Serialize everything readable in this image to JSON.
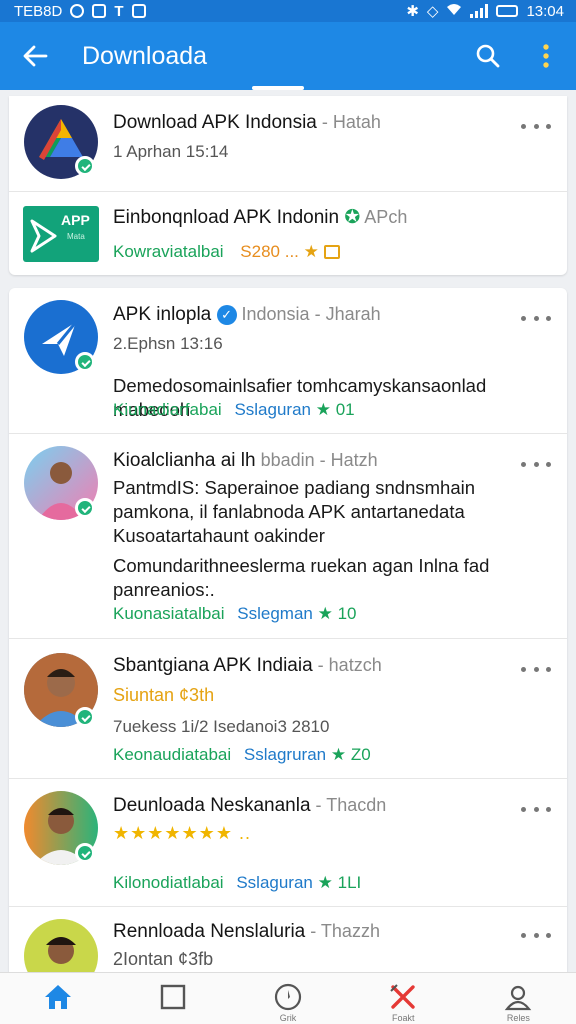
{
  "status_bar": {
    "left_text": "TEB8D",
    "time": "13:04"
  },
  "app_bar": {
    "title": "Downloada"
  },
  "card1": {
    "item1": {
      "name": "Download APK Indonsia",
      "meta": " - Hatah",
      "sub": "1 Aprhan 15:14"
    },
    "item2": {
      "name": "Einbonqnload APK Indonin",
      "meta": " APch",
      "logo_text": "APP",
      "logo_sub": "Mata",
      "foot_green": "Kowraviatalbai",
      "foot_price": "S280 ...",
      "brand_color": "#12a37a"
    }
  },
  "feed": [
    {
      "name": "APK inlopla",
      "meta": " Indonsia - Jharah",
      "sub": "2.Ephsn 13:16",
      "body": "Demedosomainlsafier tomhcamyskansaonlad mabeooh",
      "foot_green": "Kiunadiarfabai",
      "foot_blue": "Sslaguran",
      "foot_count": "01"
    },
    {
      "name": "Kioalclianha ai lh",
      "meta": " bbadin - Hatzh",
      "body": "PantmdIS: Saperainoe padiang sndnsmhain pamkona, il fanlabnoda APK antartanedata Kusoatartahaunt oakinder",
      "body2": "Comundarithneeslerma ruekan agan Inlna fad panreanios:.",
      "foot_green": "Kuonasiatalbai",
      "foot_blue": "Sslegman",
      "foot_count": "10"
    },
    {
      "name": "Sbantgiana APK Indiaia",
      "meta": " - hatzch",
      "badge": "Siuntan ¢3th",
      "sub": "7uekess 1i/2 Isedanoi3 2810",
      "foot_green": "Keonaudiatabai",
      "foot_blue": "Sslagruran",
      "foot_count": "Z0"
    },
    {
      "name": "Deunloada Neskananla",
      "meta": " - Thacdn",
      "rating_text": "★★★★★★★ ..",
      "foot_green": "Kilonodiatlabai",
      "foot_blue": "Sslaguran",
      "foot_count": "1LI"
    },
    {
      "name": "Rennloada Nenslaluria",
      "meta": " - Thazzh",
      "sub": "2Iontan ¢3fb"
    }
  ],
  "bottom_nav": [
    {
      "label": "",
      "icon": "home-icon"
    },
    {
      "label": "",
      "icon": "square-icon"
    },
    {
      "label": "Grik",
      "icon": "compass-icon"
    },
    {
      "label": "Foakt",
      "icon": "tools-icon"
    },
    {
      "label": "Reles",
      "icon": "profile-icon"
    }
  ],
  "colors": {
    "primary": "#1e88e5",
    "status": "#1976d2",
    "online": "#21b47b",
    "link_green": "#1aa35a",
    "link_blue": "#1f7ac9"
  }
}
